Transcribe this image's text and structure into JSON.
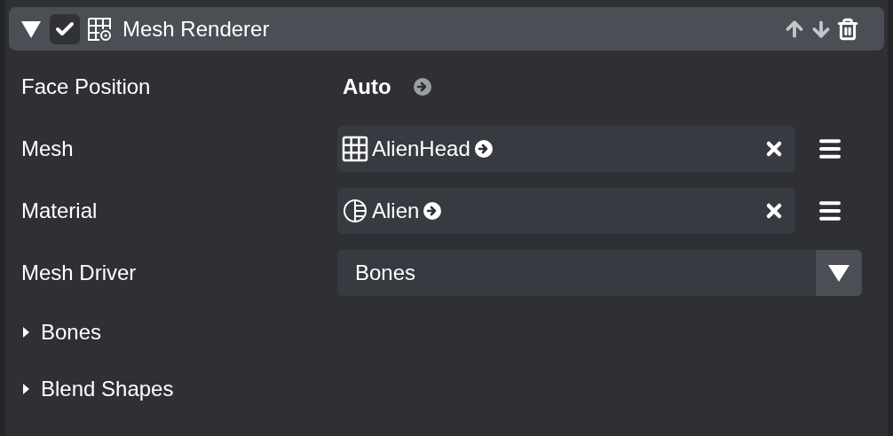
{
  "component": {
    "title": "Mesh Renderer",
    "expanded": true,
    "enabled": true
  },
  "properties": [
    {
      "kind": "value",
      "label": "Face Position",
      "value": "Auto"
    },
    {
      "kind": "reference",
      "label": "Mesh",
      "icon": {
        "kind": "mesh"
      },
      "value": "AlienHead"
    },
    {
      "kind": "reference",
      "label": "Material",
      "icon": {
        "kind": "material"
      },
      "value": "Alien"
    },
    {
      "kind": "dropdown",
      "label": "Mesh Driver",
      "value": "Bones"
    },
    {
      "kind": "foldout",
      "label": "Bones",
      "expanded": false
    },
    {
      "kind": "foldout",
      "label": "Blend Shapes",
      "expanded": false
    }
  ]
}
